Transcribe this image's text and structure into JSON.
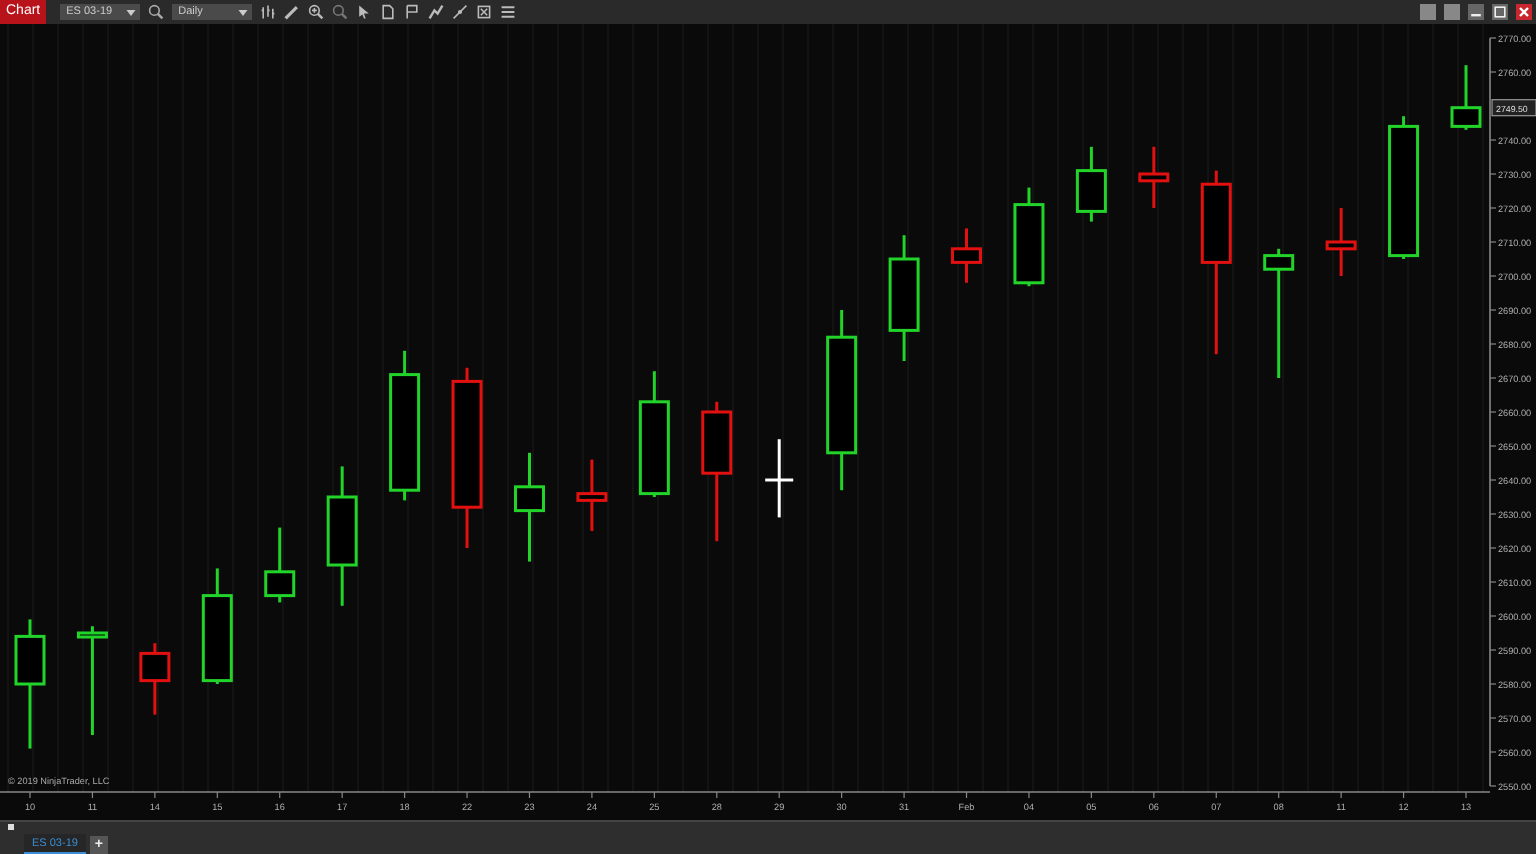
{
  "toolbar": {
    "title": "Chart",
    "instrument": "ES 03-19",
    "interval": "Daily"
  },
  "chart": {
    "chart_data": {
      "type": "candlestick",
      "grid": true,
      "categories": [
        "10",
        "11",
        "14",
        "15",
        "16",
        "17",
        "18",
        "22",
        "23",
        "24",
        "25",
        "28",
        "29",
        "30",
        "31",
        "Feb",
        "04",
        "05",
        "06",
        "07",
        "08",
        "11",
        "12",
        "13"
      ],
      "ohlc": [
        [
          2580,
          2599,
          2561,
          2594
        ],
        [
          2594,
          2597,
          2565,
          2595
        ],
        [
          2589,
          2592,
          2571,
          2581
        ],
        [
          2581,
          2614,
          2580,
          2606
        ],
        [
          2606,
          2626,
          2604,
          2613
        ],
        [
          2615,
          2644,
          2603,
          2635
        ],
        [
          2637,
          2678,
          2634,
          2671
        ],
        [
          2669,
          2673,
          2620,
          2632
        ],
        [
          2631,
          2648,
          2616,
          2638
        ],
        [
          2636,
          2646,
          2625,
          2634
        ],
        [
          2636,
          2672,
          2635,
          2663
        ],
        [
          2660,
          2663,
          2622,
          2642
        ],
        [
          2640,
          2652,
          2629,
          2640
        ],
        [
          2648,
          2690,
          2637,
          2682
        ],
        [
          2684,
          2712,
          2675,
          2705
        ],
        [
          2708,
          2714,
          2698,
          2704
        ],
        [
          2698,
          2726,
          2697,
          2721
        ],
        [
          2719,
          2738,
          2716,
          2731
        ],
        [
          2730,
          2738,
          2720,
          2728
        ],
        [
          2727,
          2731,
          2677,
          2704
        ],
        [
          2702,
          2708,
          2670,
          2706
        ],
        [
          2710,
          2720,
          2700,
          2708
        ],
        [
          2706,
          2747,
          2705,
          2744
        ],
        [
          2744,
          2762,
          2743,
          2749.5
        ]
      ],
      "ylim": [
        2550,
        2770
      ],
      "yticks": [
        {
          "value": 2550,
          "label": "2550.00"
        },
        {
          "value": 2560,
          "label": "2560.00"
        },
        {
          "value": 2570,
          "label": "2570.00"
        },
        {
          "value": 2580,
          "label": "2580.00"
        },
        {
          "value": 2590,
          "label": "2590.00"
        },
        {
          "value": 2600,
          "label": "2600.00"
        },
        {
          "value": 2610,
          "label": "2610.00"
        },
        {
          "value": 2620,
          "label": "2620.00"
        },
        {
          "value": 2630,
          "label": "2630.00"
        },
        {
          "value": 2640,
          "label": "2640.00"
        },
        {
          "value": 2650,
          "label": "2650.00"
        },
        {
          "value": 2660,
          "label": "2660.00"
        },
        {
          "value": 2670,
          "label": "2670.00"
        },
        {
          "value": 2680,
          "label": "2680.00"
        },
        {
          "value": 2690,
          "label": "2690.00"
        },
        {
          "value": 2700,
          "label": "2700.00"
        },
        {
          "value": 2710,
          "label": "2710.00"
        },
        {
          "value": 2720,
          "label": "2720.00"
        },
        {
          "value": 2730,
          "label": "2730.00"
        },
        {
          "value": 2740,
          "label": "2740.00"
        },
        {
          "value": 2760,
          "label": "2760.00"
        },
        {
          "value": 2770,
          "label": "2770.00"
        }
      ]
    },
    "last_price": "2749.50",
    "copyright": "© 2019 NinjaTrader, LLC"
  },
  "tabs": [
    {
      "label": "ES 03-19",
      "selected": true
    }
  ],
  "add_tab": "+"
}
